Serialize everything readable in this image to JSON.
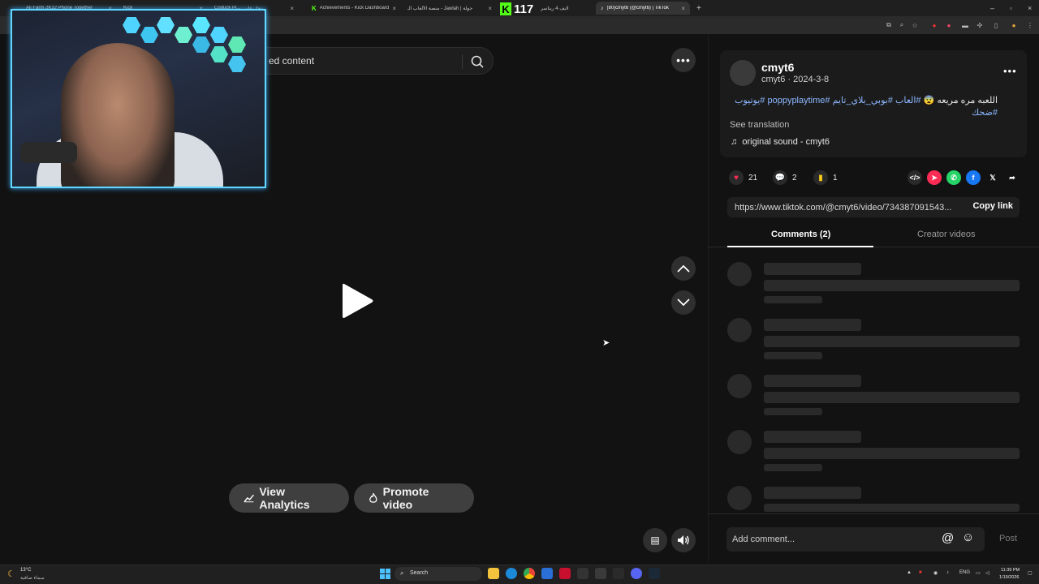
{
  "browser": {
    "tabs": [
      {
        "label": "Ali Farm 2K22 Phone Together"
      },
      {
        "label": "Kick"
      },
      {
        "label": "Coduck Pi..."
      },
      {
        "label": "رحل على"
      },
      {
        "label": "Achievements - Kick Dashboard"
      },
      {
        "label": "منصة الألعاب الـ - Jawlah | جولة"
      },
      {
        "label": "لايف 4 ريتاسر"
      },
      {
        "label": "(80)cmyt6 (@cmyt6) | TikTok"
      }
    ],
    "viewer_count": "117",
    "new_tab": "+"
  },
  "video": {
    "search_text": "ed content",
    "view_analytics": "View Analytics",
    "promote_video": "Promote video"
  },
  "post": {
    "author": "cmyt6",
    "meta": "cmyt6 · 2024-3-8",
    "caption_text": "اللعبه مره مريعه 😨",
    "caption_tags": "#العاب #بوبي_بلاي_تايم #poppyplaytime #يوتيوب #ضحك",
    "see_translation": "See translation",
    "sound": "original sound - cmyt6",
    "likes": "21",
    "comments": "2",
    "saves": "1",
    "link": "https://www.tiktok.com/@cmyt6/video/734387091543...",
    "copy_link": "Copy link",
    "tab_comments": "Comments (2)",
    "tab_creator": "Creator videos",
    "comment_placeholder": "Add comment...",
    "post_label": "Post"
  },
  "taskbar": {
    "weather_temp": "13°C",
    "weather_desc": "سماء صافية",
    "search": "Search",
    "lang": "ENG",
    "time": "11:39 PM",
    "date": "1/19/2026"
  },
  "colors": {
    "like": "#fe2c55",
    "save": "#facd15",
    "tag": "#8cb7ff",
    "cam_border": "#5fd7ff"
  }
}
